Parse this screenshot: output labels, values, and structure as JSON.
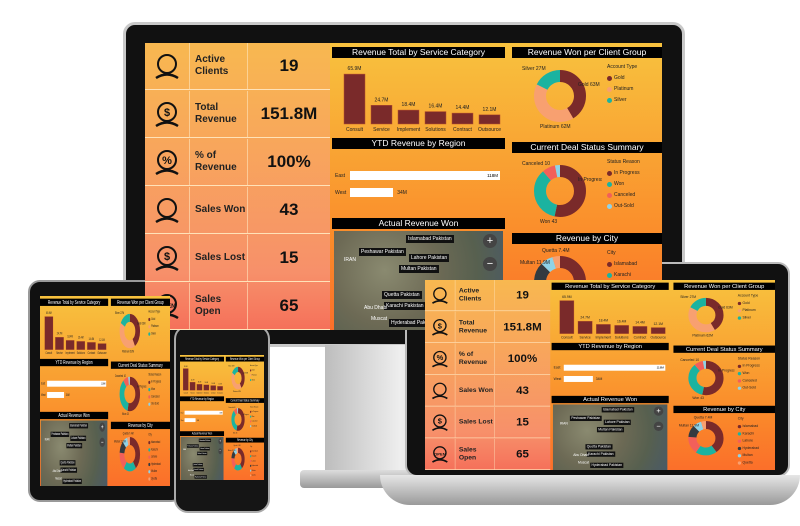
{
  "kpis": [
    {
      "label": "Active Clients",
      "value": "19",
      "icon": "client-cart-icon"
    },
    {
      "label": "Total Revenue",
      "value": "151.8M",
      "icon": "money-hand-icon"
    },
    {
      "label": "% of Revenue",
      "value": "100%",
      "icon": "percent-hand-icon"
    },
    {
      "label": "Sales Won",
      "value": "43",
      "icon": "trophy-icon"
    },
    {
      "label": "Sales Lost",
      "value": "15",
      "icon": "dollar-chart-icon"
    },
    {
      "label": "Sales Open",
      "value": "65",
      "icon": "open-sign-icon"
    }
  ],
  "chart_data": [
    {
      "type": "bar",
      "title": "Revenue Total by Service Category",
      "categories": [
        "Consult",
        "Service",
        "Implement",
        "Solutions",
        "Contract",
        "Outsource"
      ],
      "values": [
        65.9,
        24.7,
        18.4,
        16.4,
        14.4,
        12.1
      ],
      "data_labels": [
        "65.9M",
        "24.7M",
        "18.4M",
        "16.4M",
        "14.4M",
        "12.1M"
      ],
      "color": "#7a2a2a"
    },
    {
      "type": "bar",
      "orientation": "horizontal",
      "title": "YTD Revenue by Region",
      "categories": [
        "East",
        "West"
      ],
      "values": [
        118,
        34
      ],
      "data_labels": [
        "118M",
        "34M"
      ],
      "color": "#ffffff"
    },
    {
      "type": "pie",
      "donut": true,
      "title": "Revenue Won per Client Group",
      "legend_title": "Account Type",
      "categories": [
        "Gold",
        "Platinum",
        "Silver"
      ],
      "values": [
        63,
        62,
        27
      ],
      "data_labels": [
        "Gold 63M",
        "Platinum 62M",
        "Silver 27M"
      ],
      "colors": [
        "#7a2a2a",
        "#f8a070",
        "#1bb3a0"
      ]
    },
    {
      "type": "pie",
      "donut": true,
      "title": "Current Deal Status Summary",
      "legend_title": "Status Reason",
      "categories": [
        "In Progress",
        "Won",
        "Canceled",
        "Out-Sold"
      ],
      "values": [
        65,
        43,
        10,
        4
      ],
      "data_labels": [
        "In Progress 65",
        "Won 43",
        "Canceled 10",
        ""
      ],
      "colors": [
        "#7a2a2a",
        "#1bb3a0",
        "#f2605a",
        "#8fd3e8"
      ]
    },
    {
      "type": "pie",
      "donut": true,
      "title": "Revenue by City",
      "legend_title": "City",
      "categories": [
        "Islamabad",
        "Karachi",
        "Lahore",
        "Hyderabad",
        "Multan",
        "Quetta"
      ],
      "values": [
        60,
        30,
        25,
        17,
        11.9,
        7.4
      ],
      "data_labels": [
        "",
        "",
        "",
        "",
        "Multan 11.9M",
        "Quetta 7.4M"
      ],
      "colors": [
        "#7a2a2a",
        "#1bb3a0",
        "#f2605a",
        "#333a40",
        "#8fd3e8",
        "#f8a070"
      ]
    }
  ],
  "map": {
    "title": "Actual Revenue Won",
    "pins": [
      "Islamabad Pakistan",
      "Peshawar Pakistan",
      "Lahore Pakistan",
      "Multan Pakistan",
      "Quetta Pakistan",
      "Karachi Pakistan",
      "Hyderabad Pakistan"
    ],
    "places": [
      "IRAN",
      "Abu Dhabi",
      "Muscat"
    ],
    "zoom_in": "+",
    "zoom_out": "−"
  }
}
